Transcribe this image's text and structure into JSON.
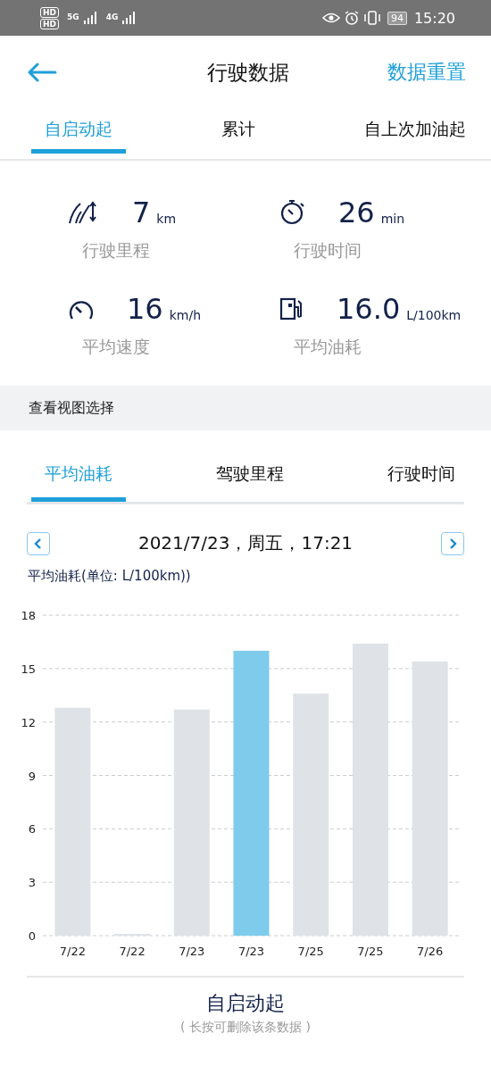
{
  "status_bar": {
    "sim_labels": [
      "HD",
      "HD"
    ],
    "networks": [
      "5G",
      "4G"
    ],
    "battery": "94",
    "time": "15:20"
  },
  "header": {
    "title": "行驶数据",
    "action": "数据重置"
  },
  "tabs": [
    {
      "label": "自启动起",
      "selected": true
    },
    {
      "label": "累计",
      "selected": false
    },
    {
      "label": "自上次加油起",
      "selected": false
    }
  ],
  "stats": [
    {
      "kind": "distance",
      "value": "7",
      "unit": "km",
      "label": "行驶里程"
    },
    {
      "kind": "time",
      "value": "26",
      "unit": "min",
      "label": "行驶时间"
    },
    {
      "kind": "speed",
      "value": "16",
      "unit": "km/h",
      "label": "平均速度"
    },
    {
      "kind": "fuel",
      "value": "16.0",
      "unit": "L/100km",
      "label": "平均油耗"
    }
  ],
  "view_section": {
    "title": "查看视图选择"
  },
  "view_tabs": [
    {
      "label": "平均油耗",
      "selected": true
    },
    {
      "label": "驾驶里程",
      "selected": false
    },
    {
      "label": "行驶时间",
      "selected": false
    }
  ],
  "date": "2021/7/23，周五，17:21",
  "chart_label": "平均油耗(单位: L/100km))",
  "chart_data": {
    "type": "bar",
    "categories": [
      "7/22",
      "7/22",
      "7/23",
      "7/23",
      "7/25",
      "7/25",
      "7/26"
    ],
    "series": [
      {
        "color": "#dfe3e7",
        "values": [
          12.8,
          0.1,
          12.7,
          null,
          13.6,
          16.4,
          15.4
        ]
      },
      {
        "color": "#7ecbec",
        "values": [
          null,
          null,
          null,
          16.0,
          null,
          null,
          null
        ]
      }
    ],
    "grid": true,
    "ylim": [
      0,
      18
    ],
    "yticks": [
      0,
      3,
      6,
      9,
      12,
      15,
      18
    ]
  },
  "footer": {
    "title": "自启动起",
    "hint": "( 长按可删除该条数据 )"
  }
}
